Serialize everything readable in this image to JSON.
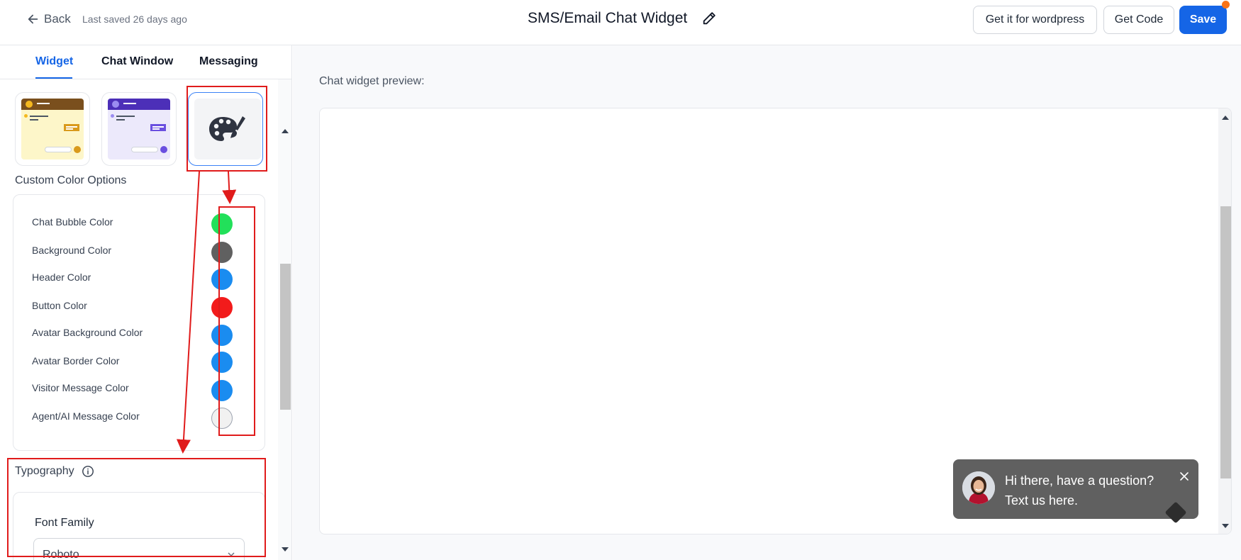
{
  "header": {
    "back_label": "Back",
    "last_saved": "Last saved 26 days ago",
    "title": "SMS/Email Chat Widget",
    "buttons": {
      "wordpress": "Get it for wordpress",
      "get_code": "Get Code",
      "save": "Save"
    }
  },
  "sidebar": {
    "tabs": [
      {
        "label": "Widget",
        "active": true
      },
      {
        "label": "Chat Window",
        "active": false
      },
      {
        "label": "Messaging",
        "active": false
      }
    ],
    "themes": [
      {
        "name": "yellow-theme",
        "accent": "#7a4f1d",
        "bg": "#fdf6c9"
      },
      {
        "name": "purple-theme",
        "accent": "#4c2fb8",
        "bg": "#ece9fb"
      },
      {
        "name": "custom-palette",
        "selected": true
      }
    ],
    "custom_color_title": "Custom Color Options",
    "colors": [
      {
        "label": "Chat Bubble Color",
        "value": "#22e05a"
      },
      {
        "label": "Background Color",
        "value": "#606060"
      },
      {
        "label": "Header Color",
        "value": "#1a8cf0"
      },
      {
        "label": "Button Color",
        "value": "#f21b1b"
      },
      {
        "label": "Avatar Background Color",
        "value": "#1a8cf0"
      },
      {
        "label": "Avatar Border Color",
        "value": "#1a8cf0"
      },
      {
        "label": "Visitor Message Color",
        "value": "#1a8cf0"
      },
      {
        "label": "Agent/AI Message Color",
        "value": "#f1f1f1"
      }
    ],
    "typography": {
      "title": "Typography",
      "font_family_label": "Font Family",
      "font_family_value": "Roboto"
    }
  },
  "preview": {
    "label": "Chat widget preview:",
    "bubble_line1": "Hi there, have a question?",
    "bubble_line2": "Text us here."
  },
  "colors": {
    "accent": "#1565e6",
    "annotation": "#e01b1b",
    "notification_dot": "#f97316"
  }
}
